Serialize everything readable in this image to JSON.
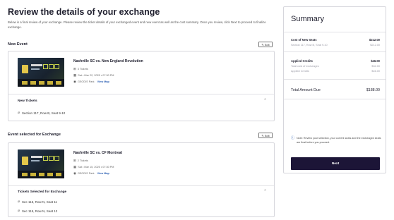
{
  "page": {
    "title": "Review the details of your exchange",
    "intro": "Below is a final review of your exchange. Please review the ticket details of your exchanged event and new event as well as the cost summary. Once you review, click Next to proceed to finalize exchange."
  },
  "new_event": {
    "heading": "New Event",
    "edit_label": "Edit",
    "name": "Nashville SC vs. New England Revolution",
    "tickets": "3 Tickets",
    "date": "Sat • Mar 22, 2025 • 07:30 PM",
    "venue": "GEODIS Park",
    "view_map": "View Map",
    "subsection_title": "New Tickets",
    "seats": [
      "Section 117, Row B, Seat 9-10"
    ]
  },
  "exchange_event": {
    "heading": "Event selected for Exchange",
    "edit_label": "Edit",
    "name": "Nashville SC vs. CF Montreal",
    "tickets": "2 Tickets",
    "date": "Sat • Mar 15, 2025 • 07:30 PM",
    "venue": "GEODIS Park",
    "view_map": "View Map",
    "subsection_title": "Tickets Selected for Exchange",
    "seats": [
      "Sec 115, Row N, Seat 11",
      "Sec 115, Row N, Seat 12"
    ]
  },
  "summary": {
    "title": "Summary",
    "cost_label": "Cost of New Seats",
    "cost_value": "$212.00",
    "cost_detail_label": "Section 117, Row B, Seat 9-10",
    "cost_detail_value": "$212.00",
    "credit_label": "Applied Credits",
    "credit_value": "$46.00",
    "credit_sub1_label": "Total cost of exchanges",
    "credit_sub1_value": "$32.00",
    "credit_sub2_label": "Applied Credits",
    "credit_sub2_value": "$46.00",
    "total_label": "Total Amount Due",
    "total_value": "$188.00",
    "note": "Note: Review your selection, your current seats and the exchanged seats are final before you proceed.",
    "next_label": "Next"
  },
  "icons": {
    "edit": "pencil-icon",
    "tickets": "ticket-icon",
    "date": "calendar-icon",
    "venue": "location-pin-icon",
    "seat": "seat-icon",
    "collapse": "chevron-up-icon",
    "info": "info-icon"
  },
  "colors": {
    "primary_button": "#1c1537",
    "link": "#2b5fb3"
  }
}
